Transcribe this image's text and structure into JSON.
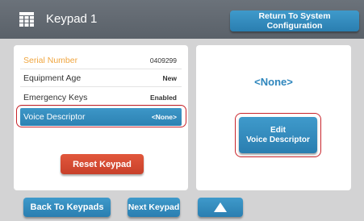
{
  "header": {
    "title": "Keypad 1",
    "icon": "keypad-grid-icon",
    "return_label": "Return To System Configuration"
  },
  "details": {
    "rows": [
      {
        "label": "Serial Number",
        "value": "0409299"
      },
      {
        "label": "Equipment Age",
        "value": "New"
      },
      {
        "label": "Emergency Keys",
        "value": "Enabled"
      },
      {
        "label": "Voice Descriptor",
        "value": "<None>"
      }
    ],
    "reset_label": "Reset Keypad"
  },
  "voice": {
    "current": "<None>",
    "edit_line1": "Edit",
    "edit_line2": "Voice Descriptor"
  },
  "footer": {
    "back_label": "Back To Keypads",
    "next_label": "Next Keypad",
    "up_icon": "triangle-up-icon"
  },
  "colors": {
    "header_bg": "#5f666e",
    "button_blue": "#2f86b9",
    "button_red": "#d24a31",
    "serial_label": "#f0a640",
    "highlight_ring": "#c8242b",
    "none_text": "#2e86bd"
  }
}
